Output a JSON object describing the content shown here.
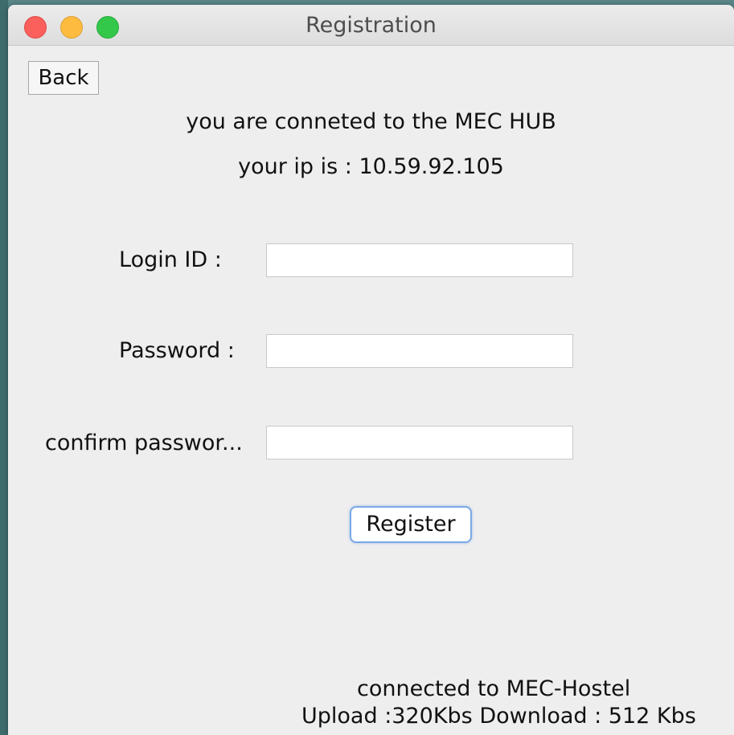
{
  "window": {
    "title": "Registration"
  },
  "toolbar": {
    "back_label": "Back"
  },
  "info": {
    "connection_message": "you are conneted to the MEC HUB",
    "ip_message": "your ip is : 10.59.92.105"
  },
  "form": {
    "login_label": "Login ID :",
    "login_value": "",
    "password_label": "Password :",
    "password_value": "",
    "confirm_label": "confirm passwor...",
    "confirm_value": "",
    "register_label": "Register"
  },
  "status": {
    "network": "connected to MEC-Hostel",
    "speed": "Upload :320Kbs Download : 512 Kbs"
  },
  "colors": {
    "close": "#fc605c",
    "minimize": "#fdbc40",
    "maximize": "#34c84a",
    "focus_ring": "#7aa9e6"
  }
}
